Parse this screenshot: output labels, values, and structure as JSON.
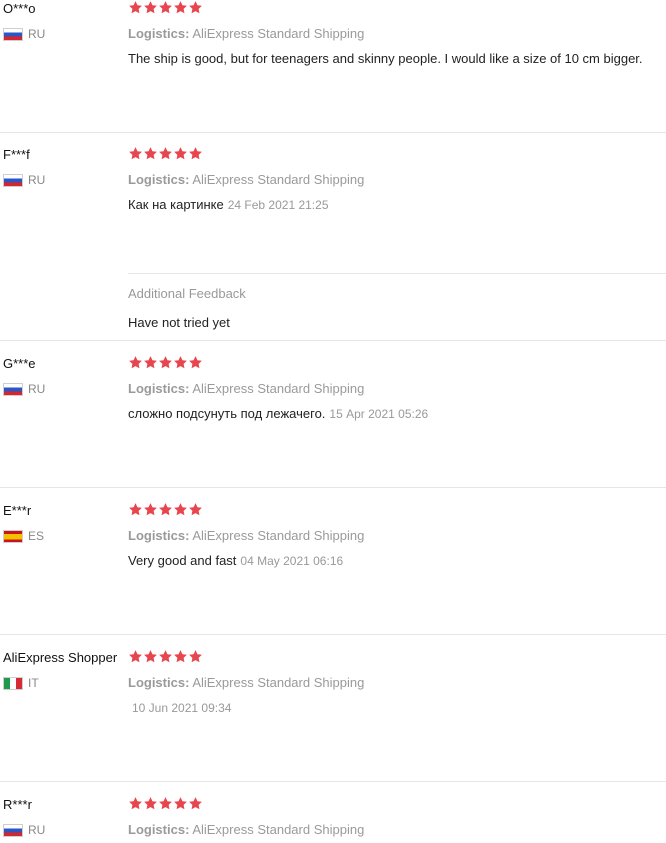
{
  "logistics_label": "Logistics:",
  "reviews": [
    {
      "user": "O***o",
      "country": "RU",
      "stars": 5,
      "logistics": "AliExpress Standard Shipping",
      "comment": "The ship is good, but for teenagers and skinny people. I would like a size of 10 cm bigger.",
      "date": ""
    },
    {
      "user": "F***f",
      "country": "RU",
      "stars": 5,
      "logistics": "AliExpress Standard Shipping",
      "comment": "Как на картинке",
      "date": "24 Feb 2021 21:25",
      "additional_title": "Additional Feedback",
      "additional_text": "Have not tried yet"
    },
    {
      "user": "G***e",
      "country": "RU",
      "stars": 5,
      "logistics": "AliExpress Standard Shipping",
      "comment": "сложно подсунуть под лежачего.",
      "date": "15 Apr 2021 05:26"
    },
    {
      "user": "E***r",
      "country": "ES",
      "stars": 5,
      "logistics": "AliExpress Standard Shipping",
      "comment": "Very good and fast",
      "date": "04 May 2021 06:16"
    },
    {
      "user": "AliExpress Shopper",
      "country": "IT",
      "stars": 5,
      "logistics": "AliExpress Standard Shipping",
      "comment": "",
      "date": "10 Jun 2021 09:34"
    },
    {
      "user": "R***r",
      "country": "RU",
      "stars": 5,
      "logistics": "AliExpress Standard Shipping",
      "comment": "",
      "date": ""
    }
  ],
  "colors": {
    "star": "#e8464f",
    "muted": "#9a9a9a",
    "divider": "#e6e6e6"
  },
  "icons": {
    "star": "star-icon",
    "flag": "flag-icon"
  }
}
